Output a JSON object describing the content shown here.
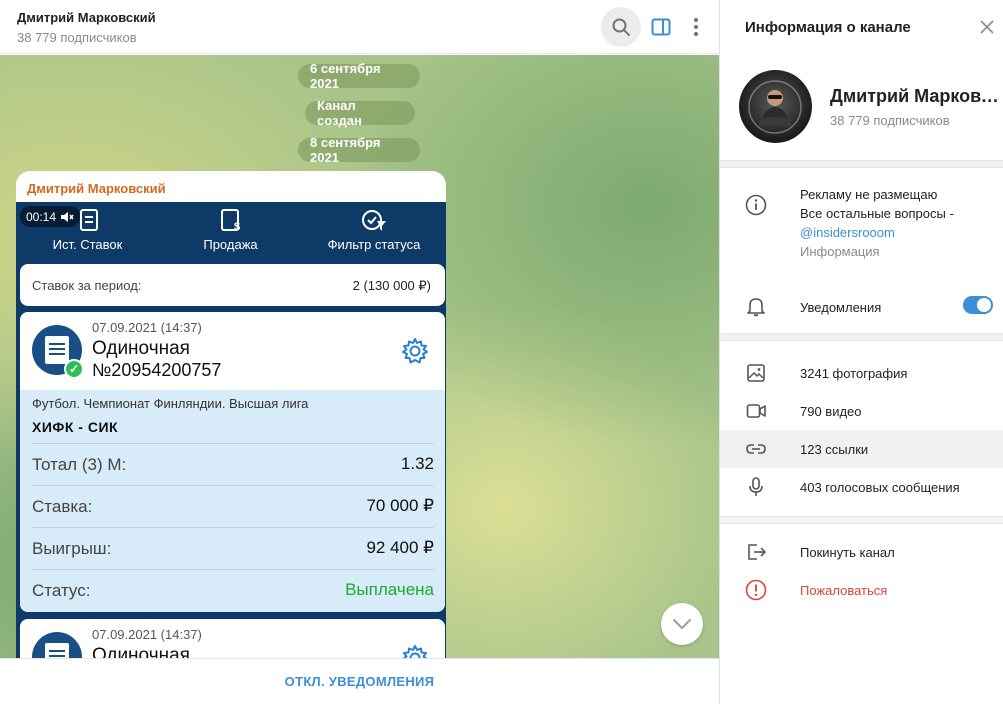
{
  "chat": {
    "title": "Дмитрий Марковский",
    "subscribers": "38 779 подписчиков",
    "dates": [
      "6 сентября 2021",
      "Канал создан",
      "8 сентября 2021"
    ],
    "footer_button": "ОТКЛ. УВЕДОМЛЕНИЯ"
  },
  "message": {
    "author": "Дмитрий Марковский",
    "video_time": "00:14",
    "app_tabs": [
      "Ист. Ставок",
      "Продажа",
      "Фильтр статуса"
    ],
    "period_label": "Ставок за период:",
    "period_value": "2 (130 000 ₽)",
    "bets": [
      {
        "date": "07.09.2021 (14:37)",
        "type": "Одиночная",
        "number": "№20954200757",
        "league": "Футбол. Чемпионат Финляндии. Высшая лига",
        "match": "ХИФК - СИК",
        "rows": [
          {
            "key": "Тотал (3) М:",
            "value": "1.32"
          },
          {
            "key": "Ставка:",
            "value": "70 000 ₽"
          },
          {
            "key": "Выигрыш:",
            "value": "92 400 ₽"
          },
          {
            "key": "Статус:",
            "value": "Выплачена"
          }
        ]
      },
      {
        "date": "07.09.2021 (14:37)",
        "type": "Одиночная"
      }
    ]
  },
  "info": {
    "title": "Информация о канале",
    "name": "Дмитрий Марковский",
    "subscribers": "38 779 подписчиков",
    "about": [
      "Рекламу не размещаю",
      "Все остальные вопросы -",
      "@insidersrooom"
    ],
    "about_caption": "Информация",
    "notifications_label": "Уведомления",
    "notifications_on": true,
    "media": [
      {
        "icon": "photo-icon",
        "label": "3241 фотография"
      },
      {
        "icon": "video-icon",
        "label": "790 видео"
      },
      {
        "icon": "link-icon",
        "label": "123 ссылки"
      },
      {
        "icon": "mic-icon",
        "label": "403 голосовых сообщения"
      }
    ],
    "leave_label": "Покинуть канал",
    "report_label": "Пожаловаться"
  },
  "colors": {
    "accent": "#3a8fd8",
    "author": "#d4691f",
    "danger": "#d9443b",
    "paid": "#20a834",
    "app_navy": "#0e3a68"
  }
}
